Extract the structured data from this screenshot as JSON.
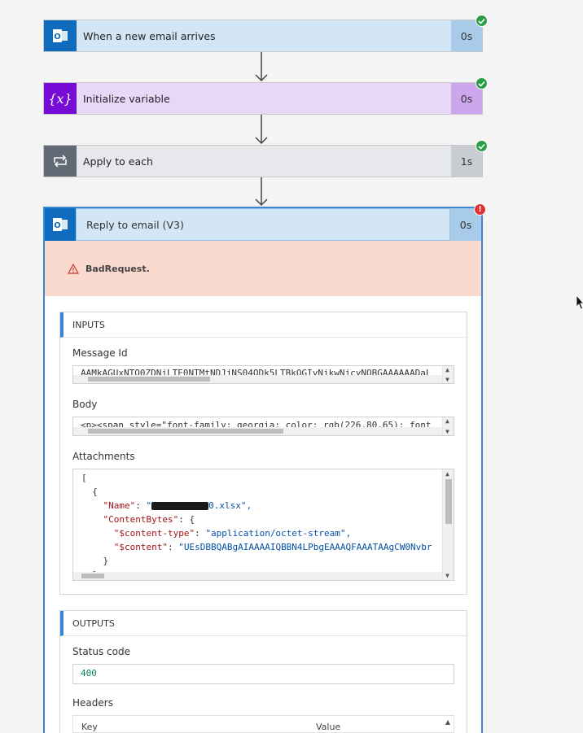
{
  "steps": [
    {
      "label": "When a new email arrives",
      "duration": "0s",
      "icon": "outlook-icon",
      "color": "#0f6cbd",
      "status": "succeeded"
    },
    {
      "label": "Initialize variable",
      "duration": "0s",
      "icon": "variable-icon",
      "color": "#770bd6",
      "status": "succeeded"
    },
    {
      "label": "Apply to each",
      "duration": "1s",
      "icon": "loop-icon",
      "color": "#616a74",
      "status": "succeeded"
    }
  ],
  "failed_step": {
    "label": "Reply to email (V3)",
    "duration": "0s",
    "icon": "outlook-icon",
    "status": "failed",
    "error_message": "BadRequest.",
    "inputs": {
      "title": "INPUTS",
      "message_id_label": "Message Id",
      "message_id_value": "AAMkAGUxNTQ0ZDNjLTE0NTMtNDJjNS04ODk5LTBkOGIyNjkwNjcyNQBGAAAAAADaL",
      "body_label": "Body",
      "body_value": "<p><span style=\"font-family: georgia; color: rgb(226,80,65); font",
      "attachments_label": "Attachments",
      "attachments_json": {
        "open_bracket": "[",
        "open_brace": "{",
        "name_key": "\"Name\"",
        "name_suffix": "0.xlsx\",",
        "contentbytes_key": "\"ContentBytes\"",
        "content_type_key": "\"$content-type\"",
        "content_type_value": "\"application/octet-stream\",",
        "content_key": "\"$content\"",
        "content_value": "\"UEsDBBQABgAIAAAAIQBBN4LPbgEAAAQFAAATAAgCW0Nvbr",
        "close_brace": "}"
      }
    },
    "outputs": {
      "title": "OUTPUTS",
      "status_code_label": "Status code",
      "status_code_value": "400",
      "headers_label": "Headers",
      "headers_columns": [
        "Key",
        "Value"
      ]
    }
  }
}
